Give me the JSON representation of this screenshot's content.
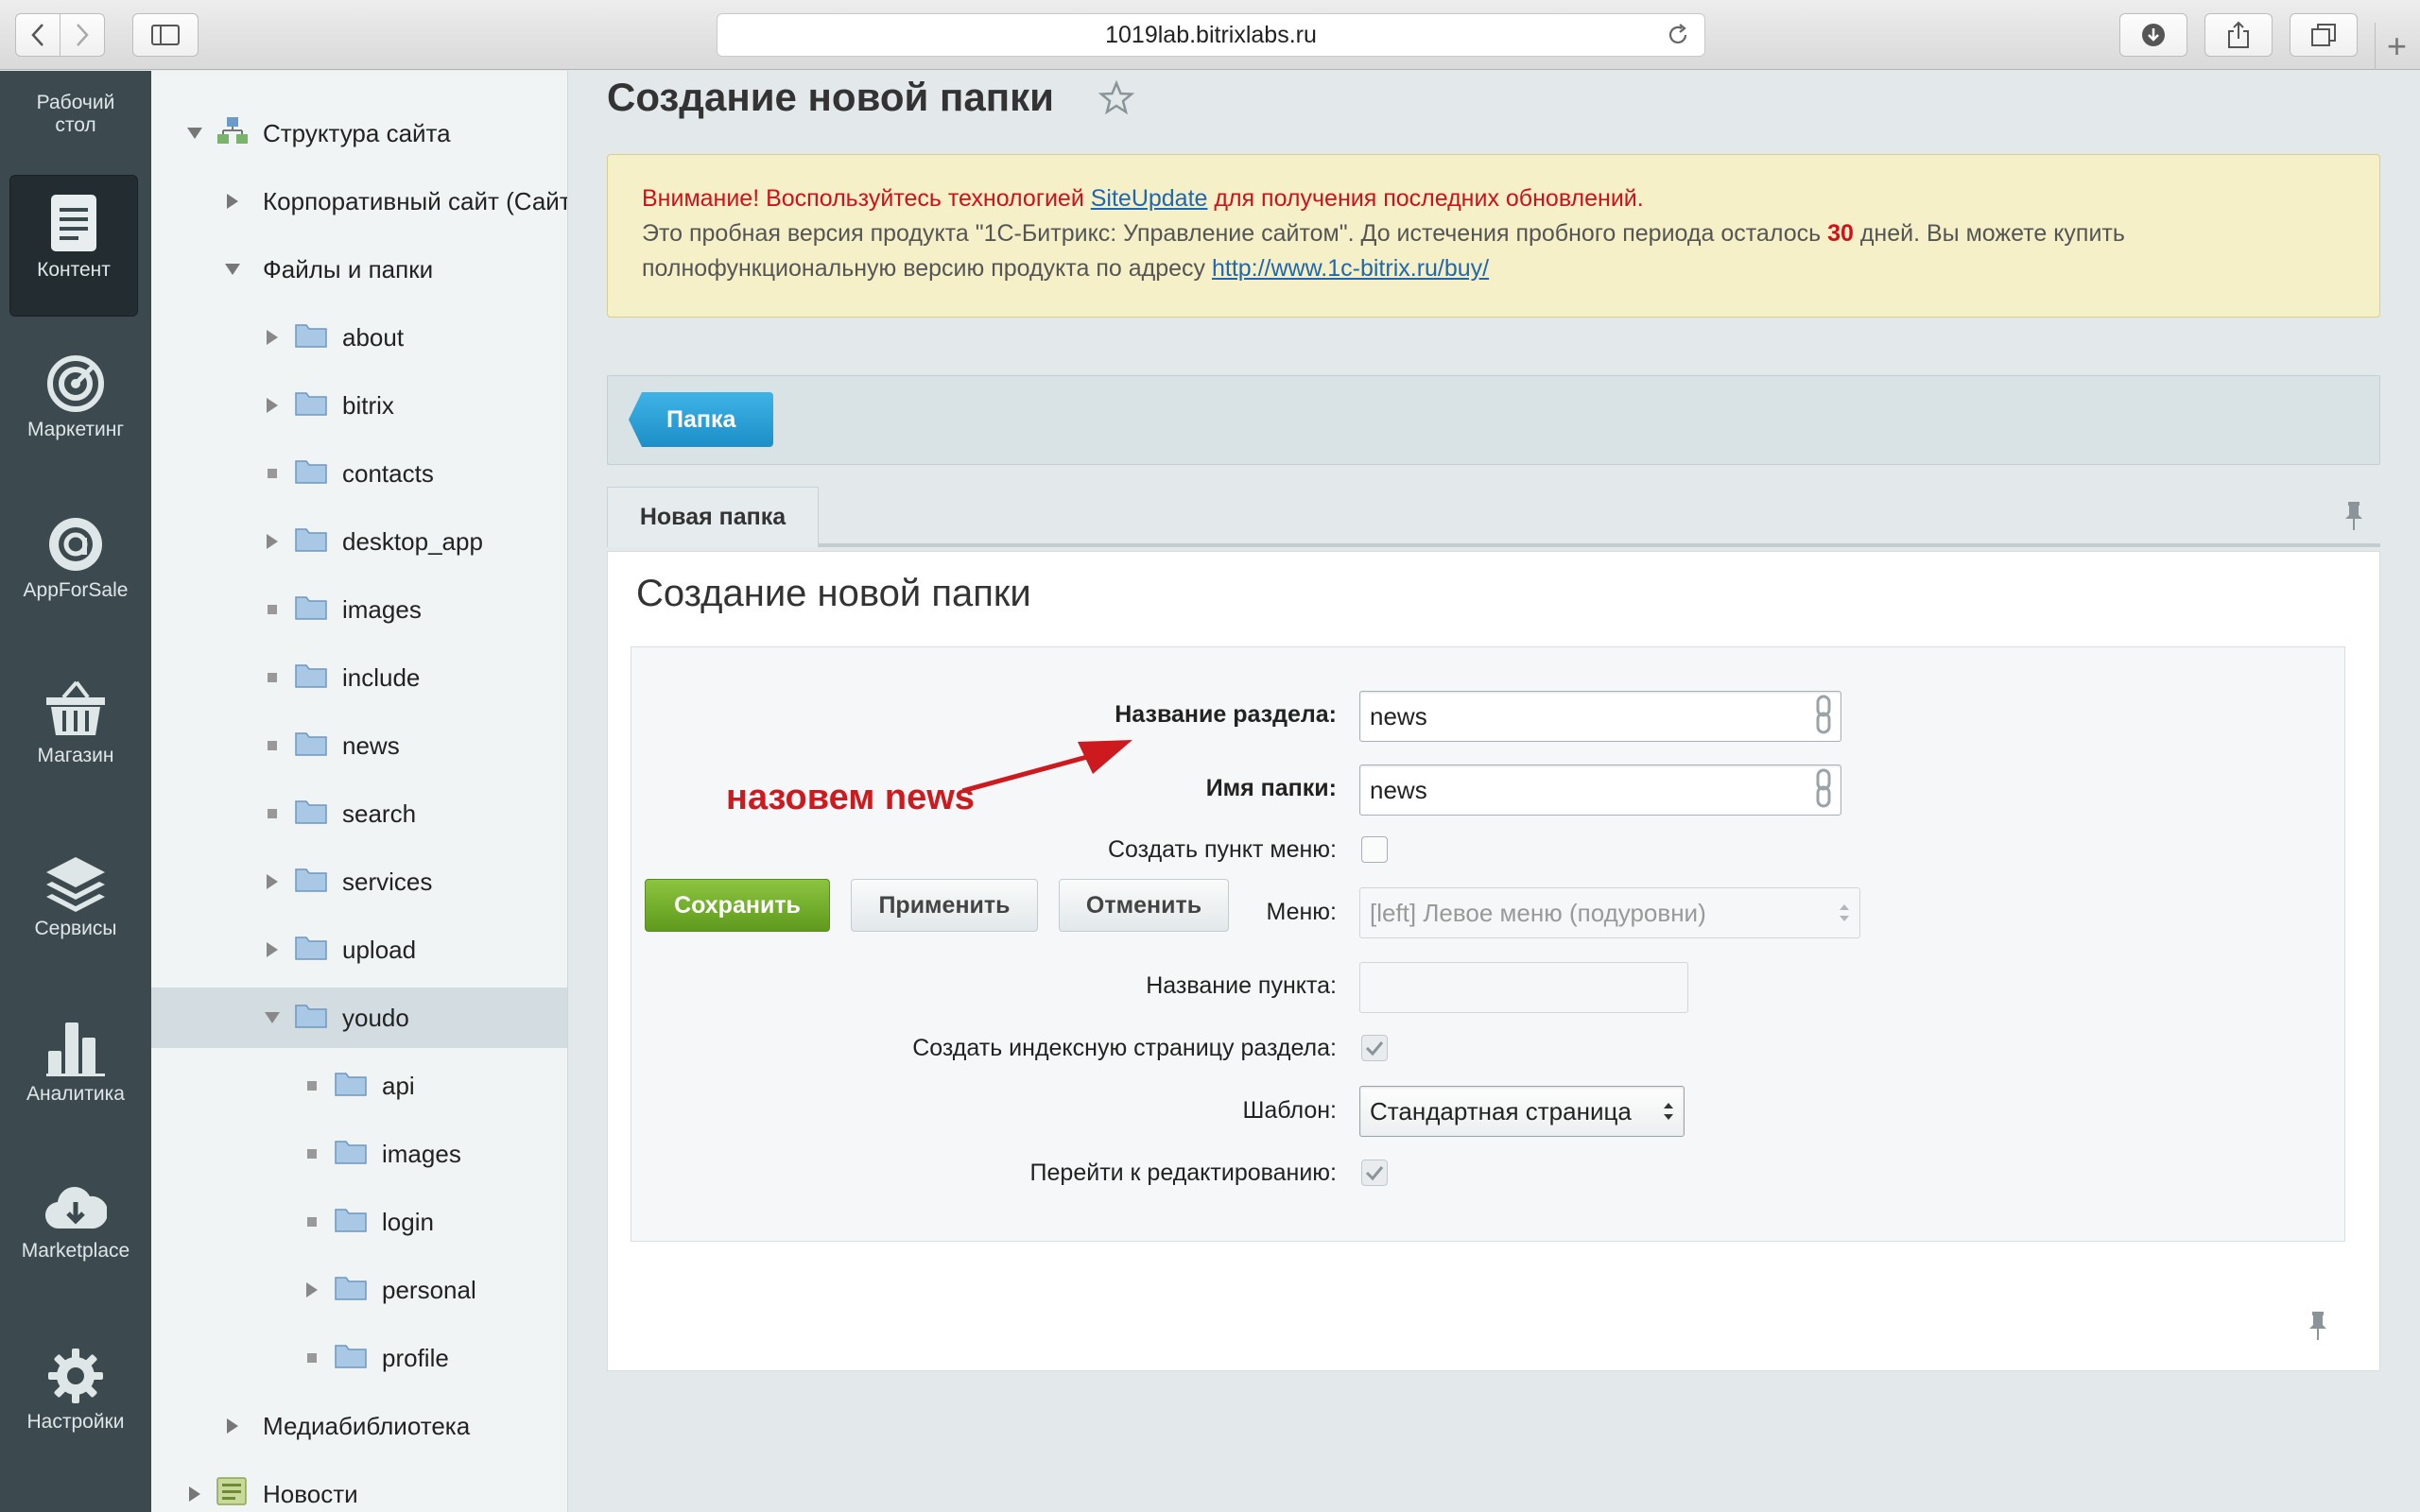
{
  "browser": {
    "url": "1019lab.bitrixlabs.ru"
  },
  "left_panel": {
    "items": [
      {
        "label": "Рабочий\nстол",
        "icon": "desktop-icon"
      },
      {
        "label": "Контент",
        "icon": "document-icon"
      },
      {
        "label": "Маркетинг",
        "icon": "target-icon"
      },
      {
        "label": "AppForSale",
        "icon": "app-icon"
      },
      {
        "label": "Магазин",
        "icon": "basket-icon"
      },
      {
        "label": "Сервисы",
        "icon": "layers-icon"
      },
      {
        "label": "Аналитика",
        "icon": "chart-icon"
      },
      {
        "label": "Marketplace",
        "icon": "cloud-download-icon"
      },
      {
        "label": "Настройки",
        "icon": "gear-icon"
      }
    ]
  },
  "tree": {
    "items": [
      {
        "label": "Структура сайта"
      },
      {
        "label": "Корпоративный сайт (Сайт"
      },
      {
        "label": "Файлы и папки"
      },
      {
        "label": "about"
      },
      {
        "label": "bitrix"
      },
      {
        "label": "contacts"
      },
      {
        "label": "desktop_app"
      },
      {
        "label": "images"
      },
      {
        "label": "include"
      },
      {
        "label": "news"
      },
      {
        "label": "search"
      },
      {
        "label": "services"
      },
      {
        "label": "upload"
      },
      {
        "label": "youdo"
      },
      {
        "label": "api"
      },
      {
        "label": "images"
      },
      {
        "label": "login"
      },
      {
        "label": "personal"
      },
      {
        "label": "profile"
      },
      {
        "label": "Медиабиблиотека"
      },
      {
        "label": "Новости"
      }
    ]
  },
  "page": {
    "title": "Создание новой папки"
  },
  "notice": {
    "line1_prefix": "Внимание! Воспользуйтесь технологией ",
    "line1_link": "SiteUpdate",
    "line1_suffix": " для получения последних обновлений.",
    "line2_prefix": "Это пробная версия продукта \"1С-Битрикс: Управление сайтом\". До истечения пробного периода осталось ",
    "line2_days": "30",
    "line2_suffix": " дней. Вы можете купить",
    "line3_prefix": "полнофункциональную версию продукта по адресу ",
    "line3_link": "http://www.1c-bitrix.ru/buy/"
  },
  "toolbar": {
    "folder_button": "Папка"
  },
  "tabs": {
    "new_folder": "Новая папка"
  },
  "form": {
    "title": "Создание новой папки",
    "section_name_label": "Название раздела:",
    "section_name_value": "news",
    "folder_name_label": "Имя папки:",
    "folder_name_value": "news",
    "create_menu_label": "Создать пункт меню:",
    "create_menu_checked": false,
    "menu_label": "Меню:",
    "menu_value": "[left] Левое меню (подуровни)",
    "item_name_label": "Название пункта:",
    "item_name_value": "",
    "create_index_label": "Создать индексную страницу раздела:",
    "create_index_checked": true,
    "template_label": "Шаблон:",
    "template_value": "Стандартная страница",
    "go_edit_label": "Перейти к редактированию:",
    "go_edit_checked": true
  },
  "annotation": {
    "text": "назовем news",
    "color": "#cc1a1f"
  },
  "buttons": {
    "save": "Сохранить",
    "apply": "Применить",
    "cancel": "Отменить"
  }
}
